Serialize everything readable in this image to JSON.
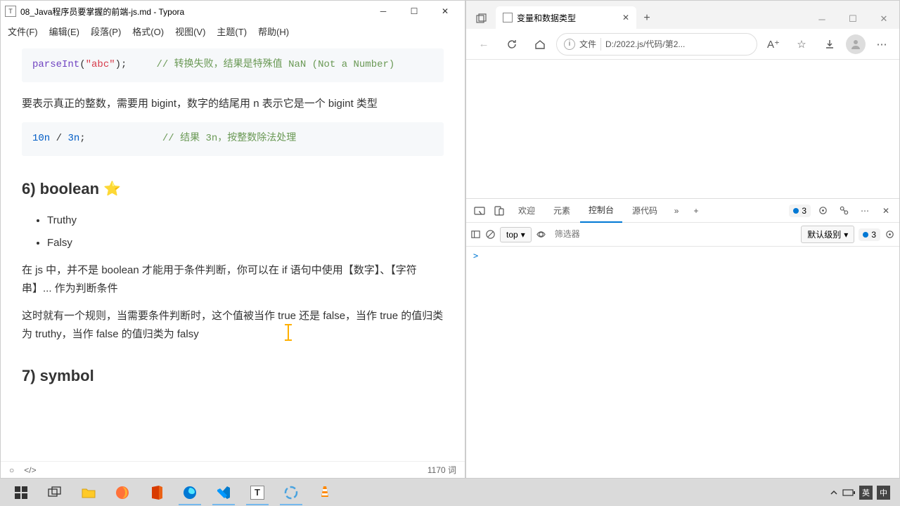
{
  "typora": {
    "title": "08_Java程序员要掌握的前端-js.md - Typora",
    "menu": [
      "文件(F)",
      "编辑(E)",
      "段落(P)",
      "格式(O)",
      "视图(V)",
      "主题(T)",
      "帮助(H)"
    ],
    "code1": {
      "fn": "parseInt",
      "paren_open": "(",
      "str": "\"abc\"",
      "paren_close": ");",
      "cmt_prefix": "// 转换失败，结果是特殊值 ",
      "nan": "NaN (Not a Number)"
    },
    "para1": "要表示真正的整数，需要用 bigint，数字的结尾用 n 表示它是一个 bigint 类型",
    "code2": {
      "expr_a": "10n",
      "op": " / ",
      "expr_b": "3n",
      "semi": ";",
      "cmt_prefix": "// 结果 ",
      "res": "3n",
      "cmt_suffix": "，按整数除法处理"
    },
    "h6": "6) boolean",
    "star": "⭐",
    "bullets": [
      "Truthy",
      "Falsy"
    ],
    "para2": "在 js 中，并不是 boolean 才能用于条件判断，你可以在 if 语句中使用【数字】、【字符串】... 作为判断条件",
    "para3": "这时就有一个规则，当需要条件判断时，这个值被当作 true 还是 false，当作 true 的值归类为 truthy，当作 false 的值归类为 falsy",
    "h7": "7) symbol",
    "word_count": "1170 词"
  },
  "browser": {
    "tab_title": "变量和数据类型",
    "addr_label": "文件",
    "addr_path": "D:/2022.js/代码/第2...",
    "devtools": {
      "tabs": [
        "欢迎",
        "元素",
        "控制台",
        "源代码"
      ],
      "active_tab": "控制台",
      "badge_count": "3",
      "context": "top",
      "filter_placeholder": "筛选器",
      "level": "默认级别",
      "badge2": "3",
      "prompt": ">"
    }
  },
  "taskbar": {
    "ime1": "英",
    "ime2": "中"
  }
}
